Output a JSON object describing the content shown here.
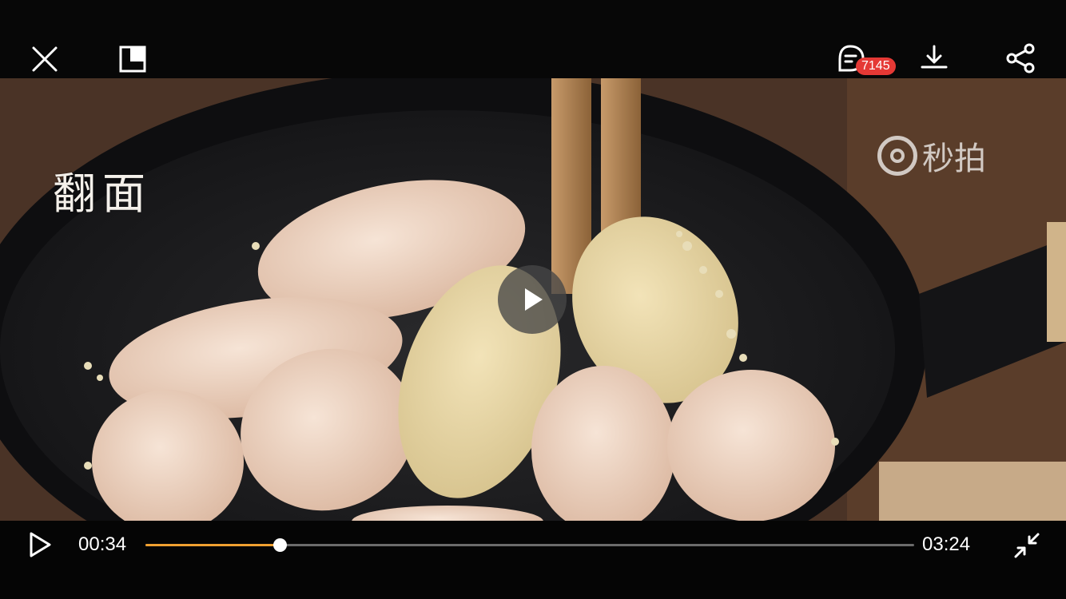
{
  "top_bar": {
    "close_icon": "close-icon",
    "pip_icon": "picture-in-picture-icon",
    "comment_icon": "comment-icon",
    "comment_count": "7145",
    "download_icon": "download-icon",
    "share_icon": "share-icon"
  },
  "video": {
    "caption": "翻面",
    "watermark_text": "秒拍",
    "play_icon": "play-icon"
  },
  "controls": {
    "play_icon": "play-icon",
    "current_time": "00:34",
    "total_time": "03:24",
    "progress": 0.175,
    "exit_fullscreen_icon": "exit-fullscreen-icon"
  },
  "colors": {
    "accent": "#f0a030",
    "badge": "#e53935",
    "track": "#6b6b6b"
  }
}
